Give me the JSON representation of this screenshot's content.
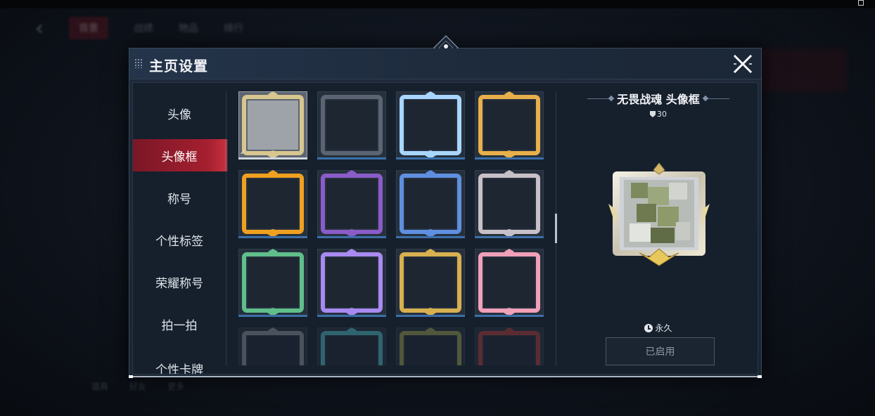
{
  "dialog": {
    "title": "主页设置",
    "icons": {
      "close": "close-icon",
      "grip": "drag-grip-icon",
      "emblem": "diamond-emblem-icon"
    }
  },
  "sidebar": {
    "items": [
      {
        "label": "头像",
        "active": false
      },
      {
        "label": "头像框",
        "active": true
      },
      {
        "label": "称号",
        "active": false
      },
      {
        "label": "个性标签",
        "active": false
      },
      {
        "label": "荣耀称号",
        "active": false
      },
      {
        "label": "拍一拍",
        "active": false
      },
      {
        "label": "个性卡牌",
        "active": false
      }
    ]
  },
  "frames": {
    "items": [
      {
        "name": "gold-wing-frame",
        "selected": true,
        "theme": "#d8c690"
      },
      {
        "name": "plain-grey-frame",
        "selected": false,
        "theme": "#5b6472"
      },
      {
        "name": "floral-butterfly-frame",
        "selected": false,
        "theme": "#a8d6ff"
      },
      {
        "name": "lantern-festival-frame",
        "selected": false,
        "theme": "#e8b04a"
      },
      {
        "name": "flame-2026-frame",
        "selected": false,
        "theme": "#f0a020"
      },
      {
        "name": "halloween-frame",
        "selected": false,
        "theme": "#8a5cc8"
      },
      {
        "name": "blue-cute-frame",
        "selected": false,
        "theme": "#5f8fe0"
      },
      {
        "name": "ruby-silver-frame",
        "selected": false,
        "theme": "#c8c0c8"
      },
      {
        "name": "emerald-frame",
        "selected": false,
        "theme": "#5fbf8a"
      },
      {
        "name": "violet-crystal-frame",
        "selected": false,
        "theme": "#a88af0"
      },
      {
        "name": "gold-wing-dark-frame",
        "selected": false,
        "theme": "#d8b050"
      },
      {
        "name": "pink-rose-frame",
        "selected": false,
        "theme": "#f0a0b8"
      },
      {
        "name": "stone-frame",
        "selected": false,
        "theme": "#8a8f98"
      },
      {
        "name": "teal-wave-frame",
        "selected": false,
        "theme": "#4fb8c0"
      },
      {
        "name": "olive-frame",
        "selected": false,
        "theme": "#9a9a50"
      },
      {
        "name": "red-gate-frame",
        "selected": false,
        "theme": "#b03a3a"
      }
    ]
  },
  "detail": {
    "title": "无畏战魂 头像框",
    "score": "30",
    "duration": "永久",
    "status_button": "已启用"
  },
  "background": {
    "tabs": [
      "背景",
      "战绩",
      "物品",
      "排行"
    ],
    "bottom": [
      "道具",
      "好友",
      "更多"
    ]
  },
  "colors": {
    "accent": "#a51f2f",
    "panel": "#1a2533"
  }
}
